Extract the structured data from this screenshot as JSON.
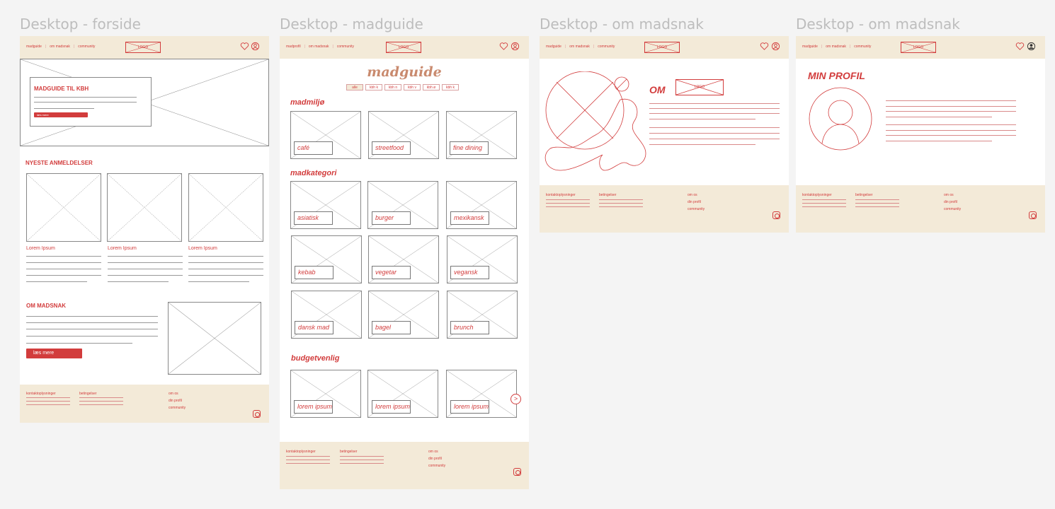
{
  "frames": [
    {
      "title": "Desktop - forside"
    },
    {
      "title": "Desktop - madguide"
    },
    {
      "title": "Desktop - om madsnak"
    },
    {
      "title": "Desktop - om madsnak"
    }
  ],
  "nav": {
    "links_a": [
      "madguide",
      "om madsnak",
      "community"
    ],
    "links_b": [
      "madprofil",
      "om madsnak",
      "community"
    ],
    "logo": "LOGO"
  },
  "forside": {
    "hero_title": "MADGUIDE TIL KBH",
    "hero_button": "læs mere",
    "reviews_heading": "NYESTE ANMELDELSER",
    "review_titles": [
      "Lorem Ipsum",
      "Lorem Ipsum",
      "Lorem Ipsum"
    ],
    "about_heading": "OM MADSNAK",
    "about_button": "læs mere"
  },
  "madguide": {
    "title": "madguide",
    "filters": [
      "alle",
      "kbh k",
      "kbh n",
      "kbh v",
      "kbh ø",
      "kbh k"
    ],
    "sections": [
      {
        "heading": "madmiljø",
        "items": [
          "café",
          "streetfood",
          "fine dining"
        ]
      },
      {
        "heading": "madkategori",
        "items": [
          "asiatisk",
          "burger",
          "mexikansk",
          "kebab",
          "vegetar",
          "vegansk",
          "dansk mad",
          "bagel",
          "brunch"
        ]
      },
      {
        "heading": "budgetvenlig",
        "items": [
          "lorem ipsum",
          "lorem ipsum",
          "lorem ipsum"
        ]
      }
    ],
    "next_arrow": ">"
  },
  "om": {
    "heading": "OM",
    "logo": "LOGO"
  },
  "profil": {
    "heading": "MIN PROFIL"
  },
  "footer": {
    "col1": "kontaktoplysninger",
    "col2": "betingelser",
    "links": [
      "om os",
      "din profil",
      "community"
    ]
  },
  "colors": {
    "accent": "#d23c3c",
    "beige": "#f3ead8",
    "canvas": "#f4f4f4"
  }
}
